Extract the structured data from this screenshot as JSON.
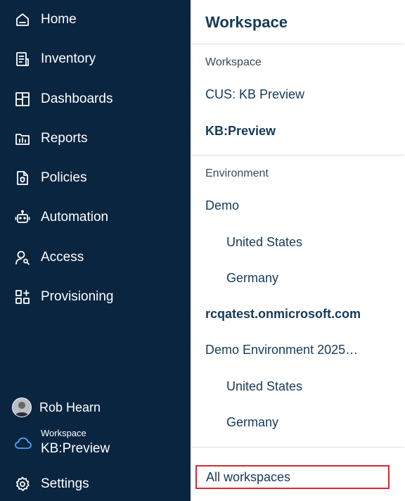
{
  "sidebar": {
    "items": [
      {
        "label": "Home",
        "icon": "home-icon"
      },
      {
        "label": "Inventory",
        "icon": "inventory-icon"
      },
      {
        "label": "Dashboards",
        "icon": "dashboards-icon"
      },
      {
        "label": "Reports",
        "icon": "reports-icon"
      },
      {
        "label": "Policies",
        "icon": "policies-icon"
      },
      {
        "label": "Automation",
        "icon": "robot-icon"
      },
      {
        "label": "Access",
        "icon": "user-search-icon"
      },
      {
        "label": "Provisioning",
        "icon": "provisioning-icon"
      }
    ],
    "user": {
      "name": "Rob Hearn",
      "icon": "avatar"
    },
    "workspace": {
      "caption": "Workspace",
      "value": "KB:Preview",
      "icon": "cloud-icon"
    },
    "settings": {
      "label": "Settings",
      "icon": "gear-icon"
    }
  },
  "panel": {
    "title": "Workspace",
    "workspace_section": {
      "label": "Workspace",
      "entries": [
        {
          "label": "CUS: KB Preview",
          "bold": false
        },
        {
          "label": "KB:Preview",
          "bold": true
        }
      ]
    },
    "environment_section": {
      "label": "Environment",
      "entries": [
        {
          "label": "Demo",
          "bold": false,
          "level": 1
        },
        {
          "label": "United States",
          "bold": false,
          "level": 2
        },
        {
          "label": "Germany",
          "bold": false,
          "level": 2
        },
        {
          "label": "rcqatest.onmicrosoft.com",
          "bold": true,
          "level": 1
        },
        {
          "label": "Demo Environment 2025…",
          "bold": false,
          "level": 1
        },
        {
          "label": "United States",
          "bold": false,
          "level": 2
        },
        {
          "label": "Germany",
          "bold": false,
          "level": 2
        }
      ]
    },
    "all_workspaces": "All workspaces"
  },
  "colors": {
    "sidebar_bg": "#0a2540",
    "panel_text": "#163a57",
    "highlight_border": "#d22a33",
    "cloud_accent": "#4aa3ff"
  }
}
